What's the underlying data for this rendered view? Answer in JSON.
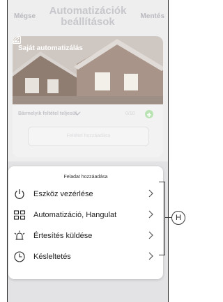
{
  "header": {
    "cancel_label": "Mégse",
    "title": "Automatizációk beállítások",
    "save_label": "Mentés"
  },
  "card": {
    "title": "Saját automatizálás",
    "condition_label": "Bármelyik feltétel teljesül",
    "condition_count": "0/10",
    "add_condition_label": "Feltétel hozzáadása"
  },
  "sheet": {
    "title": "Feladat hozzáadása",
    "items": [
      {
        "label": "Eszköz vezérlése",
        "icon": "power-icon"
      },
      {
        "label": "Automatizáció, Hangulat",
        "icon": "grid-icon"
      },
      {
        "label": "Értesítés küldése",
        "icon": "alarm-icon"
      },
      {
        "label": "Késleltetés",
        "icon": "clock-icon"
      }
    ]
  },
  "callout": {
    "marker": "H"
  }
}
